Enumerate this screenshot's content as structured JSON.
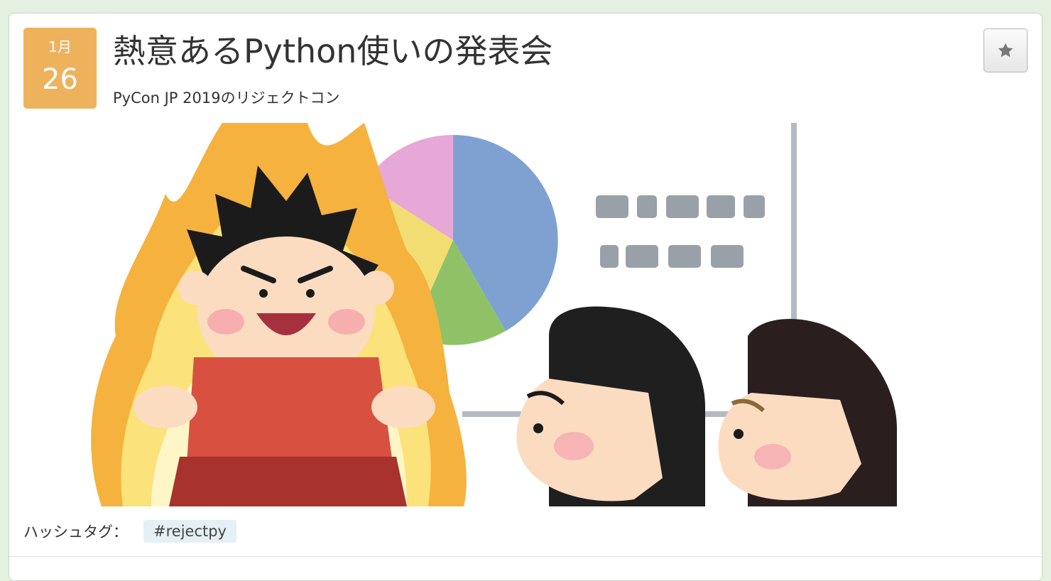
{
  "event": {
    "date": {
      "month": "1月",
      "day": "26"
    },
    "title": "熱意あるPython使いの発表会",
    "subtitle": "PyCon JP 2019のリジェクトコン",
    "bookmark_icon": "star-icon"
  },
  "banner": {
    "description_icon": "illustration-passionate-presenter"
  },
  "hashtag": {
    "label": "ハッシュタグ：",
    "tag": "#rejectpy"
  },
  "colors": {
    "background": "#e4f1e1",
    "date_badge": "#efb25c",
    "chip": "#e4f0f6"
  }
}
